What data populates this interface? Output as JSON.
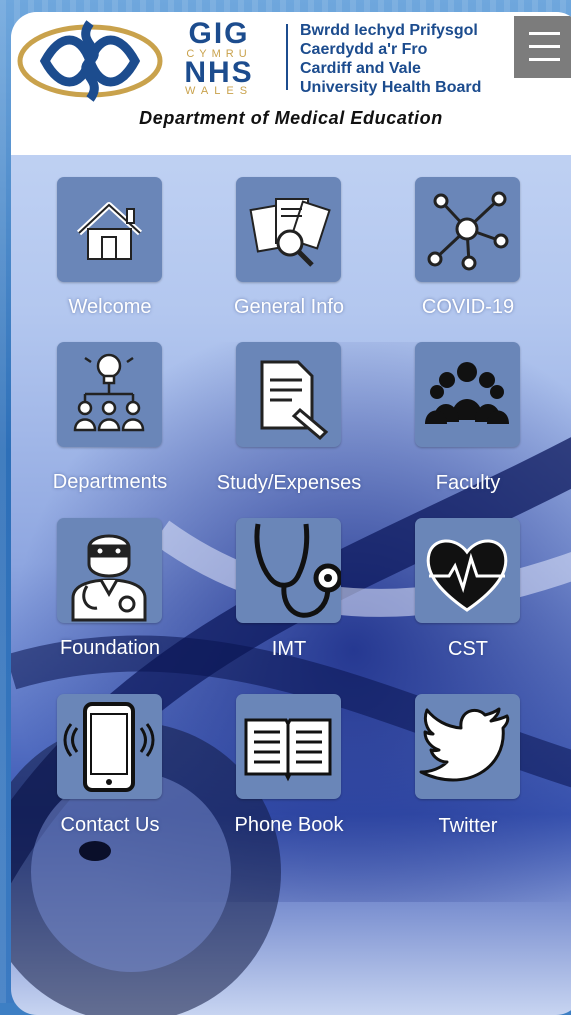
{
  "header": {
    "nhs_lines": [
      "GIG",
      "CYMRU",
      "NHS",
      "WALES"
    ],
    "board_lines": [
      "Bwrdd Iechyd Prifysgol",
      "Caerdydd a'r Fro",
      "Cardiff and Vale",
      "University Health Board"
    ],
    "department": "Department of Medical Education"
  },
  "menu": {
    "icon": "hamburger-menu-icon"
  },
  "tiles": [
    {
      "label": "Welcome",
      "icon": "house-icon"
    },
    {
      "label": "General Info",
      "icon": "documents-magnifier-icon"
    },
    {
      "label": "COVID-19",
      "icon": "virus-network-icon"
    },
    {
      "label": "Departments",
      "icon": "lightbulb-team-icon"
    },
    {
      "label": "Study/Expenses",
      "icon": "document-pen-icon"
    },
    {
      "label": "Faculty",
      "icon": "people-group-icon"
    },
    {
      "label": "Foundation",
      "icon": "doctor-icon"
    },
    {
      "label": "IMT",
      "icon": "stethoscope-icon"
    },
    {
      "label": "CST",
      "icon": "heart-pulse-icon"
    },
    {
      "label": "Contact Us",
      "icon": "phone-ringing-icon"
    },
    {
      "label": "Phone Book",
      "icon": "open-book-icon"
    },
    {
      "label": "Twitter",
      "icon": "twitter-bird-icon"
    }
  ],
  "colors": {
    "tile": "#6a86b8",
    "brand": "#1c4c8e",
    "gold": "#c9a24c",
    "menu": "#7c7c7c"
  }
}
